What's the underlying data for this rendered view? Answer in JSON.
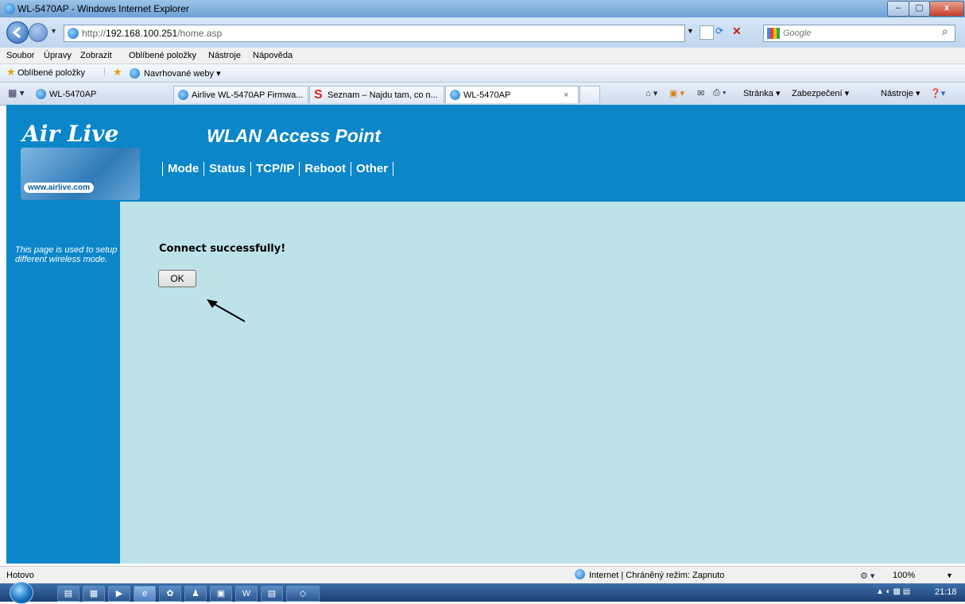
{
  "window": {
    "title": "WL-5470AP - Windows Internet Explorer",
    "min_label": "–",
    "max_label": "▢",
    "close_label": "x"
  },
  "address": {
    "url_prefix": "http://",
    "url_host": "192.168.100.251",
    "url_path": "/home.asp",
    "search_placeholder": "Google"
  },
  "menu": [
    "Soubor",
    "Úpravy",
    "Zobrazit",
    "Oblíbené položky",
    "Nástroje",
    "Nápověda"
  ],
  "favorites": {
    "label": "Oblíbené položky",
    "suggested": "Navrhované weby ▾"
  },
  "tabs": [
    {
      "label": "WL-5470AP"
    },
    {
      "label": "Airlive WL-5470AP Firmwa..."
    },
    {
      "label": "Seznam – Najdu tam, co n..."
    },
    {
      "label": "WL-5470AP"
    }
  ],
  "tab_close": "×",
  "command_bar": {
    "page": "Stránka ▾",
    "security": "Zabezpečení ▾",
    "tools": "Nástroje ▾"
  },
  "page": {
    "logo": "Air Live",
    "logo_url": "www.airlive.com",
    "title": "WLAN Access Point",
    "nav": [
      "Mode",
      "Status",
      "TCP/IP",
      "Reboot",
      "Other"
    ],
    "side_text": "This page is used to setup different wireless mode.",
    "message": "Connect successfully!",
    "ok_label": "OK"
  },
  "status": {
    "left": "Hotovo",
    "zone": "Internet | Chráněný režim: Zapnuto",
    "zoom": "100%"
  },
  "taskbar": {
    "clock": "21:18"
  }
}
